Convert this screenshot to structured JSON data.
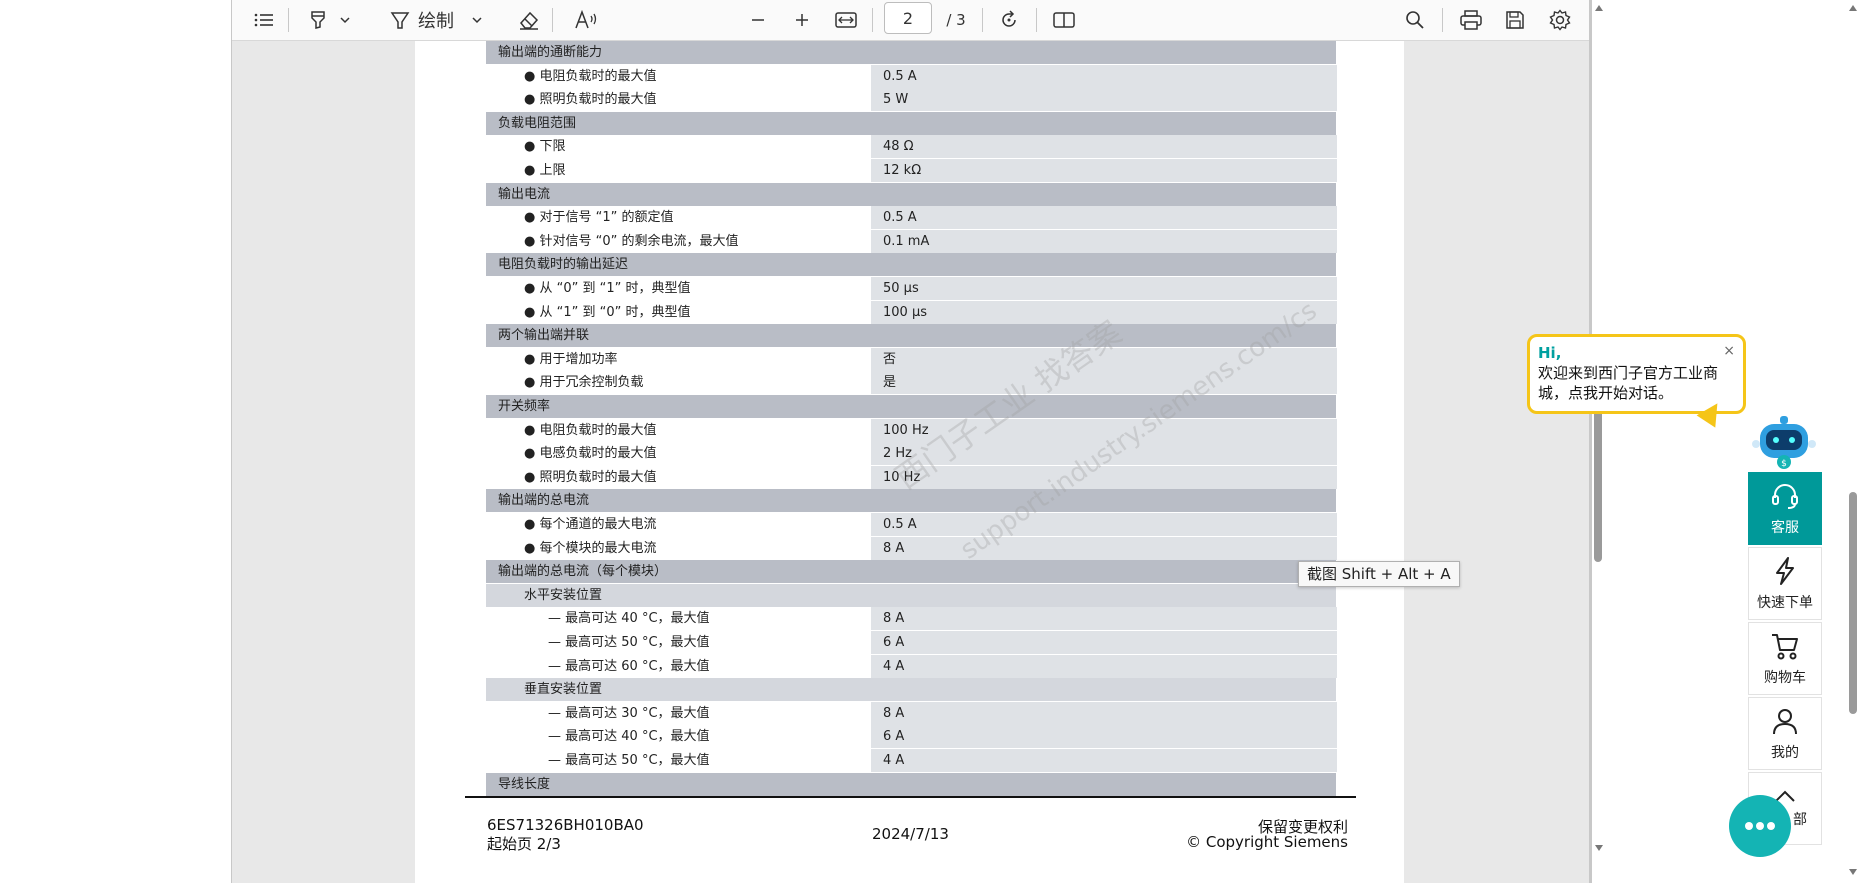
{
  "toolbar": {
    "draw_label": "绘制",
    "page_current": "2",
    "page_total": "/ 3"
  },
  "spec_rows": [
    {
      "type": "sec",
      "label": "输出端的通断能力",
      "value": ""
    },
    {
      "type": "item",
      "label": "● 电阻负载时的最大值",
      "value": "0.5 A"
    },
    {
      "type": "item",
      "label": "● 照明负载时的最大值",
      "value": "5 W"
    },
    {
      "type": "sec",
      "label": "负载电阻范围",
      "value": ""
    },
    {
      "type": "item",
      "label": "● 下限",
      "value": "48 Ω"
    },
    {
      "type": "item",
      "label": "● 上限",
      "value": "12 kΩ"
    },
    {
      "type": "sec",
      "label": "输出电流",
      "value": ""
    },
    {
      "type": "item",
      "label": "● 对于信号 “1” 的额定值",
      "value": "0.5 A"
    },
    {
      "type": "item",
      "label": "● 针对信号 “0” 的剩余电流，最大值",
      "value": "0.1 mA"
    },
    {
      "type": "sec",
      "label": "电阻负载时的输出延迟",
      "value": ""
    },
    {
      "type": "item",
      "label": "● 从 “0” 到 “1” 时，典型值",
      "value": "50 μs"
    },
    {
      "type": "item",
      "label": "● 从 “1” 到 “0” 时，典型值",
      "value": "100 μs"
    },
    {
      "type": "sec",
      "label": "两个输出端并联",
      "value": ""
    },
    {
      "type": "item",
      "label": "● 用于增加功率",
      "value": "否"
    },
    {
      "type": "item",
      "label": "● 用于冗余控制负载",
      "value": "是"
    },
    {
      "type": "sec",
      "label": "开关频率",
      "value": ""
    },
    {
      "type": "item",
      "label": "● 电阻负载时的最大值",
      "value": "100 Hz"
    },
    {
      "type": "item",
      "label": "● 电感负载时的最大值",
      "value": "2 Hz"
    },
    {
      "type": "item",
      "label": "● 照明负载时的最大值",
      "value": "10 Hz"
    },
    {
      "type": "sec",
      "label": "输出端的总电流",
      "value": ""
    },
    {
      "type": "item",
      "label": "● 每个通道的最大电流",
      "value": "0.5 A"
    },
    {
      "type": "item",
      "label": "● 每个模块的最大电流",
      "value": "8 A"
    },
    {
      "type": "sec",
      "label": "输出端的总电流（每个模块）",
      "value": ""
    },
    {
      "type": "sub",
      "label": "水平安装位置",
      "value": ""
    },
    {
      "type": "item2",
      "label": "— 最高可达 40 °C，最大值",
      "value": "8 A"
    },
    {
      "type": "item2",
      "label": "— 最高可达 50 °C，最大值",
      "value": "6 A"
    },
    {
      "type": "item2",
      "label": "— 最高可达 60 °C，最大值",
      "value": "4 A"
    },
    {
      "type": "sub",
      "label": "垂直安装位置",
      "value": ""
    },
    {
      "type": "item2",
      "label": "— 最高可达 30 °C，最大值",
      "value": "8 A"
    },
    {
      "type": "item2",
      "label": "— 最高可达 40 °C，最大值",
      "value": "6 A"
    },
    {
      "type": "item2",
      "label": "— 最高可达 50 °C，最大值",
      "value": "4 A"
    },
    {
      "type": "sec",
      "label": "导线长度",
      "value": ""
    }
  ],
  "footer": {
    "product_code": "6ES71326BH010BA0",
    "start_page": "起始页 2/3",
    "date": "2024/7/13",
    "rights": "保留变更权利",
    "copyright": "© Copyright Siemens"
  },
  "watermark": {
    "line1": "西门子工业  找答案",
    "line2": "support.industry.siemens.com/cs"
  },
  "tooltip": "截图 Shift + Alt + A",
  "chat_bubble": {
    "greeting": "Hi,",
    "message": "欢迎来到西门子官方工业商城，点我开始对话。",
    "close": "×"
  },
  "sidebar": {
    "service": "客服",
    "quick_order": "快速下单",
    "cart": "购物车",
    "mine": "我的",
    "top": "部"
  },
  "colors": {
    "accent": "#009999",
    "bubble_border": "#f5c518",
    "section_bg": "#b9bdc6",
    "value_bg": "#dfe2e6"
  }
}
